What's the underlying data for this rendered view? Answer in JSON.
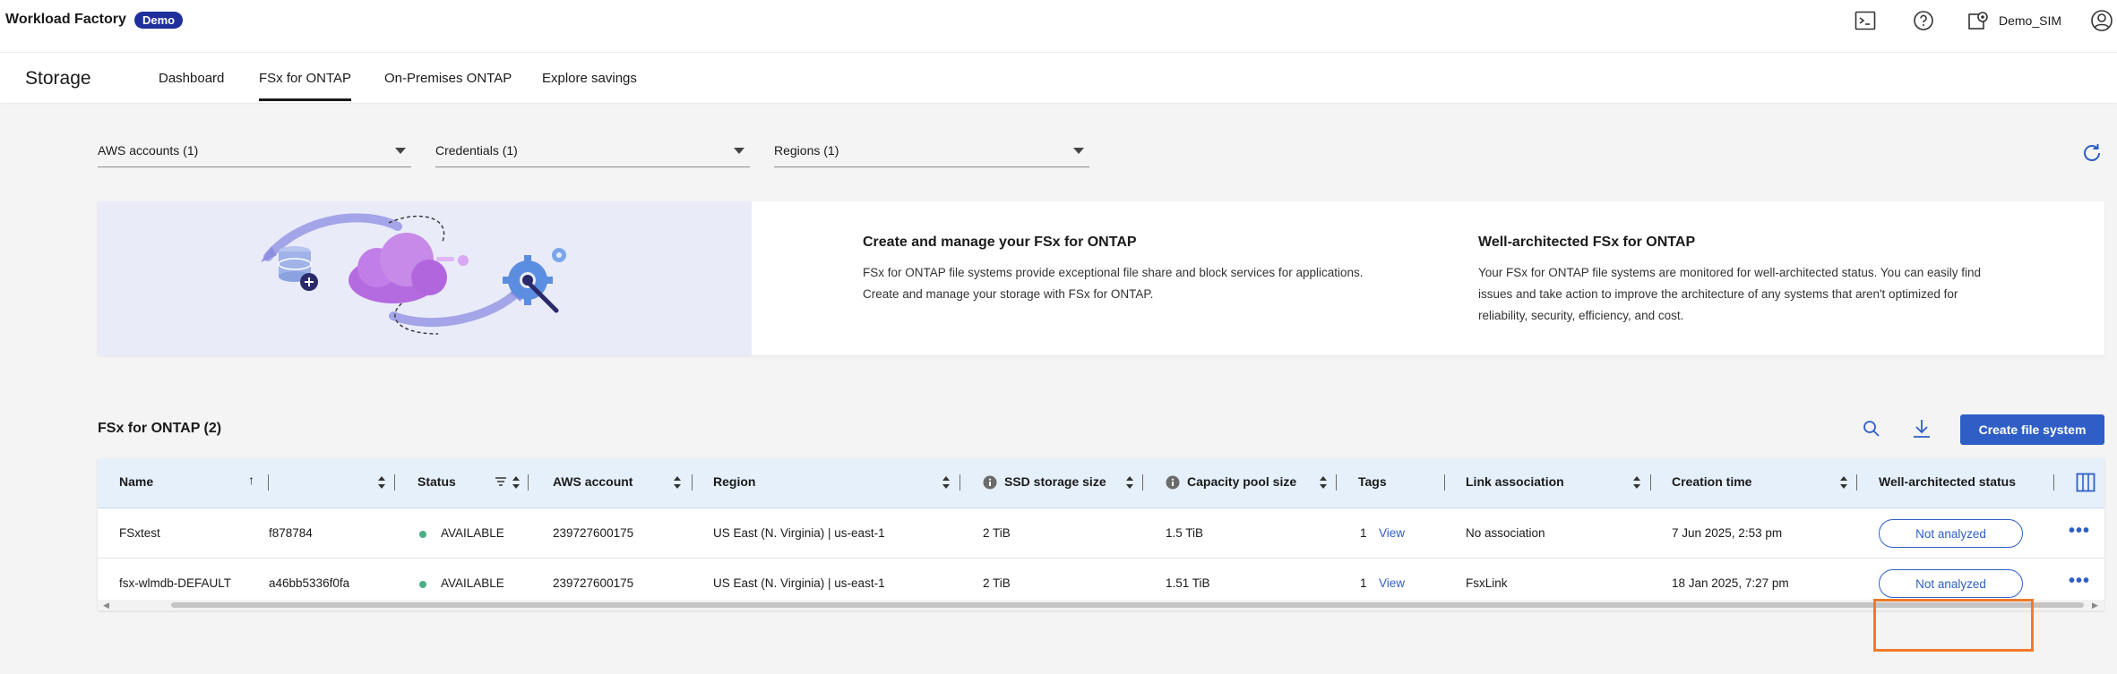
{
  "header": {
    "app_title": "Workload Factory",
    "badge": "Demo",
    "user_label": "Demo_SIM",
    "icons": [
      "terminal-icon",
      "help-icon",
      "workspace-settings-icon",
      "user-profile-icon"
    ]
  },
  "nav": {
    "brand": "Storage",
    "tabs": [
      {
        "label": "Dashboard",
        "active": false
      },
      {
        "label": "FSx for ONTAP",
        "active": true
      },
      {
        "label": "On-Premises ONTAP",
        "active": false
      },
      {
        "label": "Explore savings",
        "active": false
      }
    ]
  },
  "filters": [
    {
      "label": "AWS accounts (1)"
    },
    {
      "label": "Credentials (1)"
    },
    {
      "label": "Regions (1)"
    }
  ],
  "banner": {
    "left_title": "Create and manage your FSx for ONTAP",
    "left_line1": "FSx for ONTAP file systems provide exceptional file share and block services for applications.",
    "left_line2": "Create and manage your storage with FSx for ONTAP.",
    "right_title": "Well-architected FSx for ONTAP",
    "right_line1": "Your FSx for ONTAP file systems are monitored for well-architected status. You can easily find",
    "right_line2": "issues and take action to improve the architecture of any systems that aren't optimized for",
    "right_line3": "reliability, security, efficiency, and cost."
  },
  "table": {
    "title": "FSx for ONTAP (2)",
    "create_label": "Create file system",
    "columns": [
      "Name",
      "Status",
      "AWS account",
      "Region",
      "SSD storage size",
      "Capacity pool size",
      "Tags",
      "Link association",
      "Creation time",
      "Well-architected status"
    ],
    "rows": [
      {
        "name": "FSxtest",
        "id": "f878784",
        "status": "AVAILABLE",
        "account": "239727600175",
        "region": "US East (N. Virginia) | us-east-1",
        "ssd": "2 TiB",
        "pool": "1.5 TiB",
        "tags_count": "1",
        "tags_link": "View",
        "link": "No association",
        "created": "7 Jun 2025, 2:53 pm",
        "wa_status": "Not analyzed",
        "menu": "•••"
      },
      {
        "name": "fsx-wlmdb-DEFAULT",
        "id": "a46bb5336f0fa",
        "status": "AVAILABLE",
        "account": "239727600175",
        "region": "US East (N. Virginia) | us-east-1",
        "ssd": "2 TiB",
        "pool": "1.51 TiB",
        "tags_count": "1",
        "tags_link": "View",
        "link": "FsxLink",
        "created": "18 Jan 2025, 7:27 pm",
        "wa_status": "Not analyzed",
        "menu": "•••"
      }
    ]
  },
  "colors": {
    "accent": "#2f5fc6",
    "badge": "#1f2f9c",
    "highlight": "#f07a2b",
    "status_ok": "#4caf84"
  }
}
